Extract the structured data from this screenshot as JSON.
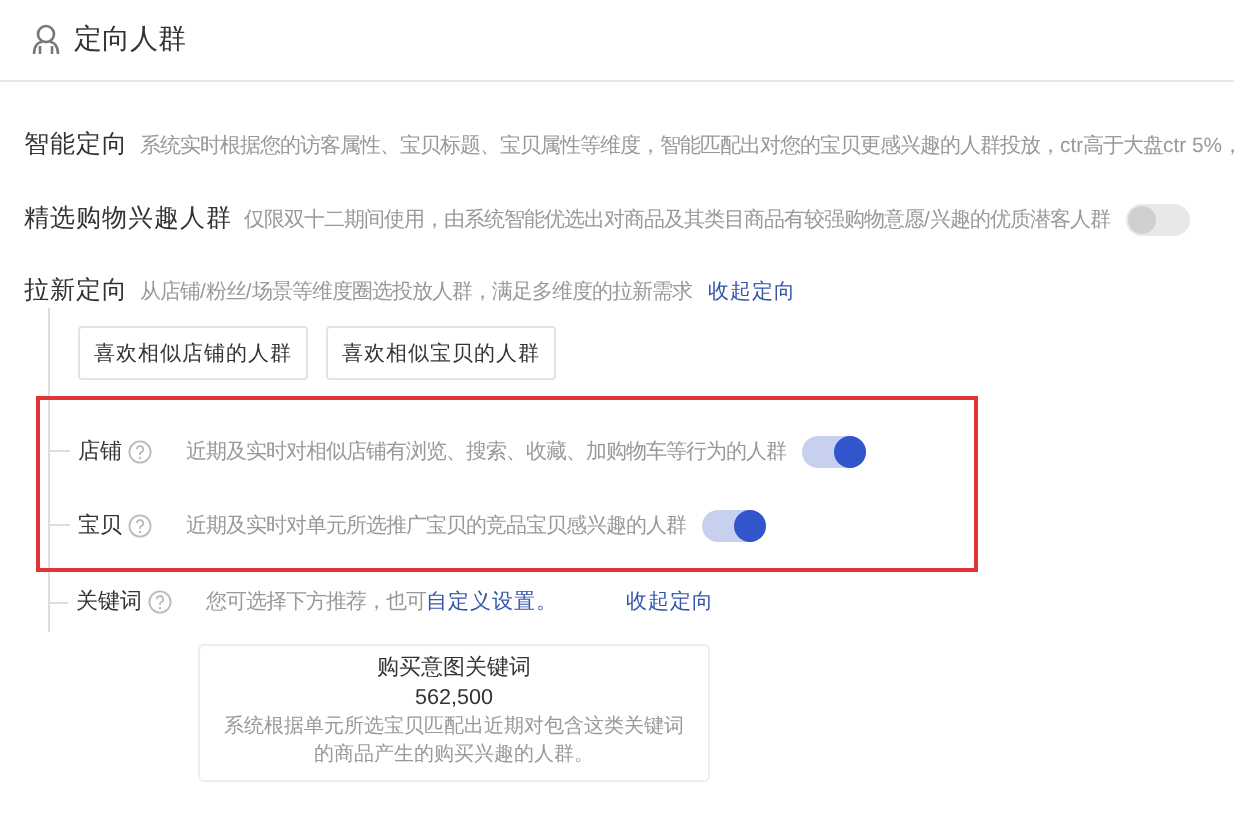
{
  "section": {
    "title": "定向人群"
  },
  "smart": {
    "label": "智能定向",
    "description": "系统实时根据您的访客属性、宝贝标题、宝贝属性等维度，智能匹配出对您的宝贝更感兴趣的人群投放，ctr高于大盘ctr 5%，"
  },
  "shopping_interest": {
    "label": "精选购物兴趣人群",
    "description": "仅限双十二期间使用，由系统智能优选出对商品及其类目商品有较强购物意愿/兴趣的优质潜客人群",
    "on": false
  },
  "new_customer": {
    "label": "拉新定向",
    "description": "从店铺/粉丝/场景等维度圈选投放人群，满足多维度的拉新需求",
    "link": "收起定向",
    "buttons": [
      "喜欢相似店铺的人群",
      "喜欢相似宝贝的人群"
    ],
    "options": [
      {
        "label": "店铺",
        "description": "近期及实时对相似店铺有浏览、搜索、收藏、加购物车等行为的人群",
        "on": true
      },
      {
        "label": "宝贝",
        "description": "近期及实时对单元所选推广宝贝的竞品宝贝感兴趣的人群",
        "on": true
      }
    ],
    "keyword": {
      "label": "关键词",
      "hint": "您可选择下方推荐，也可",
      "link": "自定义设置。",
      "collapse_link": "收起定向",
      "card": {
        "title": "购买意图关键词",
        "count": "562,500",
        "description": "系统根据单元所选宝贝匹配出近期对包含这类关键词的商品产生的购买兴趣的人群。"
      }
    }
  }
}
